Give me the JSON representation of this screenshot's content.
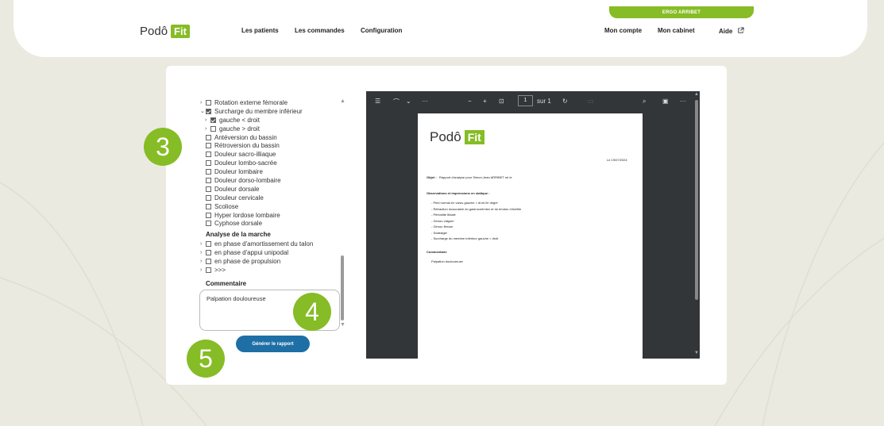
{
  "header": {
    "user_name": "ERGO ARRIBET",
    "logo_text": "Podô",
    "logo_badge": "Fit",
    "nav_left": [
      "Les patients",
      "Les commandes",
      "Configuration"
    ],
    "nav_right": [
      "Mon compte",
      "Mon cabinet",
      "Aide"
    ]
  },
  "tree": {
    "items": [
      {
        "label": "Rotation externe fémorale",
        "chevron": "›",
        "checked": false
      },
      {
        "label": "Surcharge du membre inférieur",
        "chevron": "⌄",
        "checked": true
      },
      {
        "label": "gauche < droit",
        "chevron": "›",
        "checked": true
      },
      {
        "label": "gauche > droit",
        "chevron": "›",
        "checked": false
      },
      {
        "label": "Antéversion du bassin",
        "chevron": "",
        "checked": false
      },
      {
        "label": "Rétroversion du bassin",
        "chevron": "",
        "checked": false
      },
      {
        "label": "Douleur sacro-illiaque",
        "chevron": "",
        "checked": false
      },
      {
        "label": "Douleur lombo-sacrée",
        "chevron": "",
        "checked": false
      },
      {
        "label": "Douleur lombaire",
        "chevron": "",
        "checked": false
      },
      {
        "label": "Douleur dorso-lombaire",
        "chevron": "",
        "checked": false
      },
      {
        "label": "Douleur dorsale",
        "chevron": "",
        "checked": false
      },
      {
        "label": "Douleur cervicale",
        "chevron": "",
        "checked": false
      },
      {
        "label": "Scoliose",
        "chevron": "",
        "checked": false
      },
      {
        "label": "Hyper lordose lombaire",
        "chevron": "",
        "checked": false
      },
      {
        "label": "Cyphose dorsale",
        "chevron": "",
        "checked": false
      }
    ],
    "section_title": "Analyse de la marche",
    "marche_items": [
      {
        "label": "en phase d'amortissement du talon",
        "chevron": "›"
      },
      {
        "label": "en phase d'appui unipodal",
        "chevron": "›"
      },
      {
        "label": "en phase de propulsion",
        "chevron": "›"
      },
      {
        "label": ">>>",
        "chevron": "›"
      }
    ]
  },
  "comment": {
    "label": "Commentaire",
    "value": "Palpation douloureuse"
  },
  "generate_button": "Générer le rapport",
  "steps": [
    "3",
    "4",
    "5"
  ],
  "viewer": {
    "page_current": "1",
    "page_total": "sur 1",
    "pdf": {
      "logo_text": "Podô",
      "logo_badge": "Fit",
      "date": "Le 19/07/2024",
      "object_label": "Objet :",
      "object_text": "Rapport d'analyse pour Simon-Jean ARRIBET né le",
      "obs_title": "Observations et impressions en statique :",
      "obs_items": [
        "- Pied normal en varus gauche < droit 2e degré",
        "- Rétraction musculaire du gastrocnémien et du tendon d'Achille",
        "- Périostite tibiale",
        "- Genou valgum",
        "- Genou flexum",
        "- Sciatalgie",
        "- Surcharge du membre inférieur gauche < droit"
      ],
      "comment_title": "Commentaire",
      "comment_text": "Palpation douloureuse"
    }
  },
  "colors": {
    "brand_green": "#86bc25",
    "button_blue": "#1e6fa5",
    "background": "#ebeae1",
    "viewer_dark": "#323639"
  }
}
